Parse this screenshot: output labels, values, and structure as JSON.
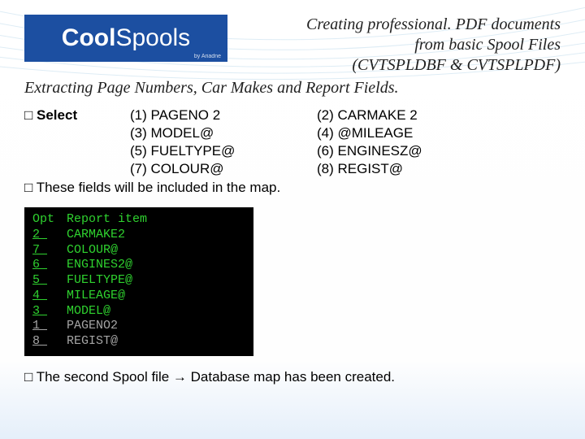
{
  "logo": {
    "brand_a": "Cool",
    "brand_b": "Spools",
    "byline": "by Ariadne"
  },
  "title": {
    "line1": "Creating professional. PDF documents",
    "line2": "from basic Spool Files",
    "line3": "(CVTSPLDBF & CVTSPLPDF)"
  },
  "subtitle": "Extracting Page Numbers, Car Makes and Report Fields.",
  "bullet_box": "□",
  "select_label": "Select",
  "fields": {
    "r1a": "(1) PAGENO 2",
    "r1b": "(2) CARMAKE 2",
    "r2a": "(3) MODEL@",
    "r2b": "(4) @MILEAGE",
    "r3a": "(5) FUELTYPE@",
    "r3b": "(6) ENGINESZ@",
    "r4a": "(7) COLOUR@",
    "r4b": "(8) REGIST@"
  },
  "note": "These fields will be included in the map.",
  "terminal": {
    "head_opt": "Opt",
    "head_item": "Report item",
    "rows": [
      {
        "opt": "2",
        "item": "CARMAKE2",
        "grey": false
      },
      {
        "opt": "7",
        "item": "COLOUR@",
        "grey": false
      },
      {
        "opt": "6",
        "item": "ENGINES2@",
        "grey": false
      },
      {
        "opt": "5",
        "item": "FUELTYPE@",
        "grey": false
      },
      {
        "opt": "4",
        "item": "MILEAGE@",
        "grey": false
      },
      {
        "opt": "3",
        "item": "MODEL@",
        "grey": false
      },
      {
        "opt": "1",
        "item": "PAGENO2",
        "grey": true
      },
      {
        "opt": "8",
        "item": "REGIST@",
        "grey": true
      }
    ]
  },
  "footer": {
    "pre": "The second Spool file ",
    "arrow": "→",
    "post": " Database map has been created."
  }
}
